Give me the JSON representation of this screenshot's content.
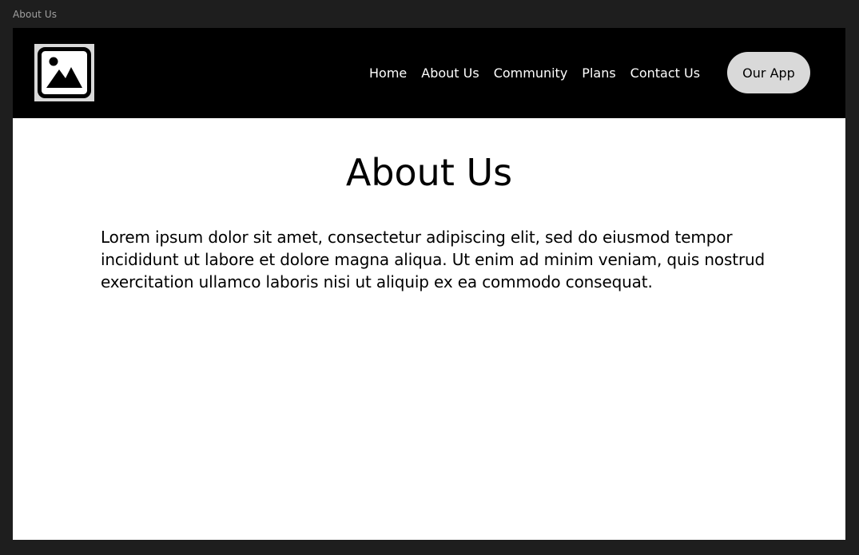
{
  "frame": {
    "label": "About Us"
  },
  "navbar": {
    "logo_icon": "image-placeholder-icon",
    "links": [
      {
        "label": "Home"
      },
      {
        "label": "About Us"
      },
      {
        "label": "Community"
      },
      {
        "label": "Plans"
      },
      {
        "label": "Contact Us"
      }
    ],
    "cta_label": "Our App"
  },
  "main": {
    "title": "About Us",
    "body": "Lorem ipsum dolor sit amet, consectetur adipiscing elit, sed do eiusmod tempor incididunt ut labore et dolore magna aliqua. Ut enim ad minim veniam, quis nostrud exercitation ullamco laboris nisi ut aliquip ex ea commodo consequat."
  },
  "colors": {
    "canvas_background": "#1e1e1e",
    "navbar_background": "#000000",
    "page_background": "#ffffff",
    "button_background": "#d9d9d9",
    "frame_label": "#a0a0a0"
  }
}
